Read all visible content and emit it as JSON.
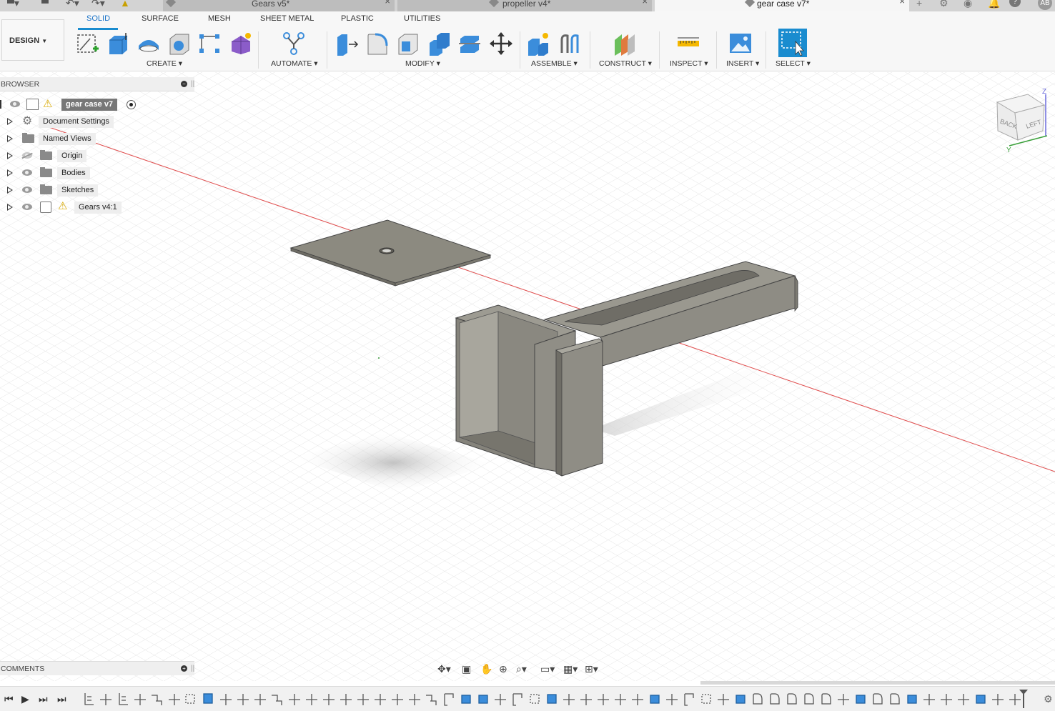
{
  "tabs": [
    {
      "name": "Gears v5*",
      "active": false
    },
    {
      "name": "propeller v4*",
      "active": false
    },
    {
      "name": "gear case v7*",
      "active": true
    }
  ],
  "user_initials": "AB",
  "workspace_button": "DESIGN",
  "workspace_tabs": [
    "SOLID",
    "SURFACE",
    "MESH",
    "SHEET METAL",
    "PLASTIC",
    "UTILITIES"
  ],
  "groups": {
    "create": "CREATE",
    "automate": "AUTOMATE",
    "modify": "MODIFY",
    "assemble": "ASSEMBLE",
    "construct": "CONSTRUCT",
    "inspect": "INSPECT",
    "insert": "INSERT",
    "select": "SELECT"
  },
  "browser": {
    "title": "BROWSER",
    "root": "gear case v7",
    "items": [
      "Document Settings",
      "Named Views",
      "Origin",
      "Bodies",
      "Sketches",
      "Gears v4:1"
    ]
  },
  "comments_title": "COMMENTS",
  "viewcube": {
    "back": "BACK",
    "left": "LEFT",
    "z": "Z",
    "y": "Y"
  },
  "colors": {
    "accent": "#1a8ccf",
    "model": "#8c8a80",
    "axis_red": "#e05050"
  }
}
